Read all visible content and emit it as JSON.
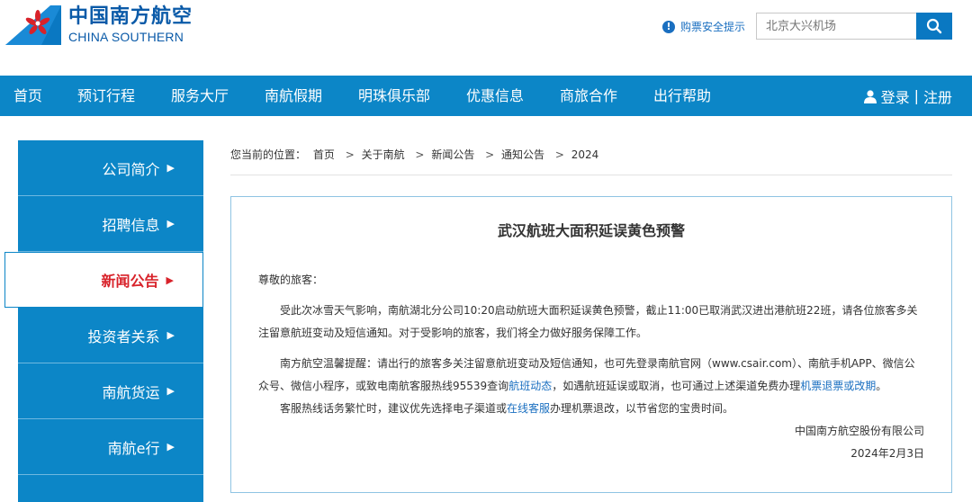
{
  "brand": {
    "cn_name": "中国南方航空",
    "en_name": "CHINA SOUTHERN",
    "color": "#0a5aa8"
  },
  "header": {
    "safety_tip": "购票安全提示",
    "search_placeholder": "北京大兴机场"
  },
  "nav": {
    "items": [
      "首页",
      "预订行程",
      "服务大厅",
      "南航假期",
      "明珠俱乐部",
      "优惠信息",
      "商旅合作",
      "出行帮助"
    ],
    "login": "登录",
    "divider": "|",
    "register": "注册",
    "color": "#0c86c7"
  },
  "sidebar": {
    "items": [
      "公司简介",
      "招聘信息",
      "新闻公告",
      "投资者关系",
      "南航货运",
      "南航e行"
    ],
    "active_index": 2,
    "arrow": "▶"
  },
  "breadcrumb": {
    "label": "您当前的位置：",
    "items": [
      "首页",
      "关于南航",
      "新闻公告",
      "通知公告",
      "2024"
    ],
    "separator": ">"
  },
  "article": {
    "title": "武汉航班大面积延误黄色预警",
    "salutation": "尊敬的旅客：",
    "p1": "受此次冰雪天气影响，南航湖北分公司10:20启动航班大面积延误黄色预警，截止11:00已取消武汉进出港航班22班，请各位旅客多关注留意航班变动及短信通知。对于受影响的旅客，我们将全力做好服务保障工作。",
    "p2_a": "南方航空温馨提醒：请出行的旅客多关注留意航班变动及短信通知，也可先登录南航官网（www.csair.com）、南航手机APP、微信公众号、微信小程序，或致电南航客服热线95539查询",
    "p2_link1": "航班动态",
    "p2_b": "，如遇航班延误或取消，也可通过上述渠道免费办理",
    "p2_link2": "机票退票或改期",
    "p2_c": "。",
    "p3_a": "客服热线话务繁忙时，建议优先选择电子渠道或",
    "p3_link": "在线客服",
    "p3_b": "办理机票退改，以节省您的宝贵时间。",
    "signature": "中国南方航空股份有限公司",
    "date": "2024年2月3日"
  }
}
